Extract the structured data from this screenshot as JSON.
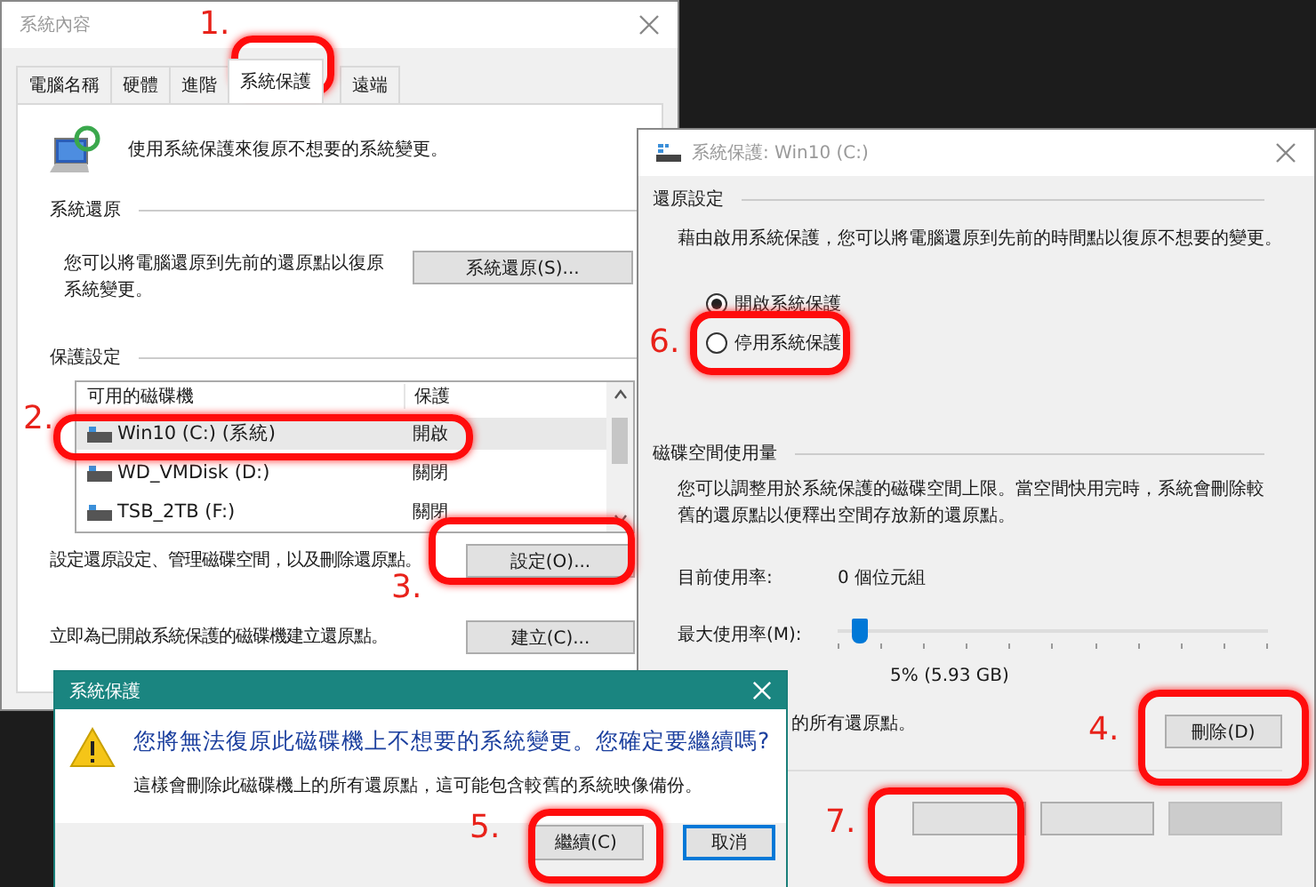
{
  "properties_window": {
    "title": "系統內容",
    "tabs": [
      {
        "label": "電腦名稱",
        "selected": false
      },
      {
        "label": "硬體",
        "selected": false
      },
      {
        "label": "進階",
        "selected": false
      },
      {
        "label": "系統保護",
        "selected": true
      },
      {
        "label": "遠端",
        "selected": false
      }
    ],
    "intro": "使用系統保護來復原不想要的系統變更。",
    "restore_heading": "系統還原",
    "restore_text": "您可以將電腦還原到先前的還原點以復原系統變更。",
    "restore_button": "系統還原(S)...",
    "protection_heading": "保護設定",
    "columns": [
      "可用的磁碟機",
      "保護"
    ],
    "rows": [
      {
        "drive": "Win10 (C:) (系統)",
        "protection": "開啟",
        "selected": true
      },
      {
        "drive": "WD_VMDisk (D:)",
        "protection": "關閉",
        "selected": false
      },
      {
        "drive": "TSB_2TB (F:)",
        "protection": "關閉",
        "selected": false
      }
    ],
    "configure_text": "設定還原設定、管理磁碟空間，以及刪除還原點。",
    "configure_button": "設定(O)...",
    "create_text": "立即為已開啟系統保護的磁碟機建立還原點。",
    "create_button": "建立(C)..."
  },
  "settings_window": {
    "title": "系統保護: Win10 (C:)",
    "restore_heading": "還原設定",
    "restore_text": "藉由啟用系統保護，您可以將電腦還原到先前的時間點以復原不想要的變更。",
    "options": [
      {
        "label": "開啟系統保護",
        "selected": true
      },
      {
        "label": "停用系統保護",
        "selected": false
      }
    ],
    "usage_heading": "磁碟空間使用量",
    "usage_text": "您可以調整用於系統保護的磁碟空間上限。當空間快用完時，系統會刪除較舊的還原點以便釋出空間存放新的還原點。",
    "current_label": "目前使用率:",
    "current_value": "0 個位元組",
    "max_label": "最大使用率(M):",
    "max_slider": {
      "level": 0.05
    },
    "max_value": "5% (5.93 GB)",
    "delete_text": "的所有還原點。",
    "delete_button": "刪除(D)"
  },
  "dialog": {
    "title": "系統保護",
    "message": "您將無法復原此磁碟機上不想要的系統變更。您確定要繼續嗎?",
    "detail": "這樣會刪除此磁碟機上的所有還原點，這可能包含較舊的系統映像備份。",
    "buttons": [
      {
        "label": "繼續(C)",
        "default": false
      },
      {
        "label": "取消",
        "default": true
      }
    ]
  },
  "annotations": [
    {
      "label": "1."
    },
    {
      "label": "2."
    },
    {
      "label": "3."
    },
    {
      "label": "4."
    },
    {
      "label": "5."
    },
    {
      "label": "6."
    },
    {
      "label": "7."
    }
  ]
}
